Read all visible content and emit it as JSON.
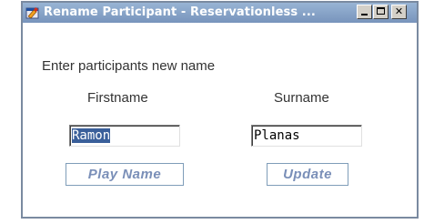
{
  "window": {
    "title": "Rename Participant - Reservationless ...",
    "icon": "app-icon",
    "controls": [
      "minimize-icon",
      "maximize-icon",
      "close-icon"
    ],
    "close_glyph": "✕"
  },
  "form": {
    "prompt": "Enter participants new name",
    "firstname_label": "Firstname",
    "surname_label": "Surname",
    "firstname_value": "Ramon",
    "surname_value": "Planas"
  },
  "buttons": {
    "play_label": "Play Name",
    "update_label": "Update"
  }
}
